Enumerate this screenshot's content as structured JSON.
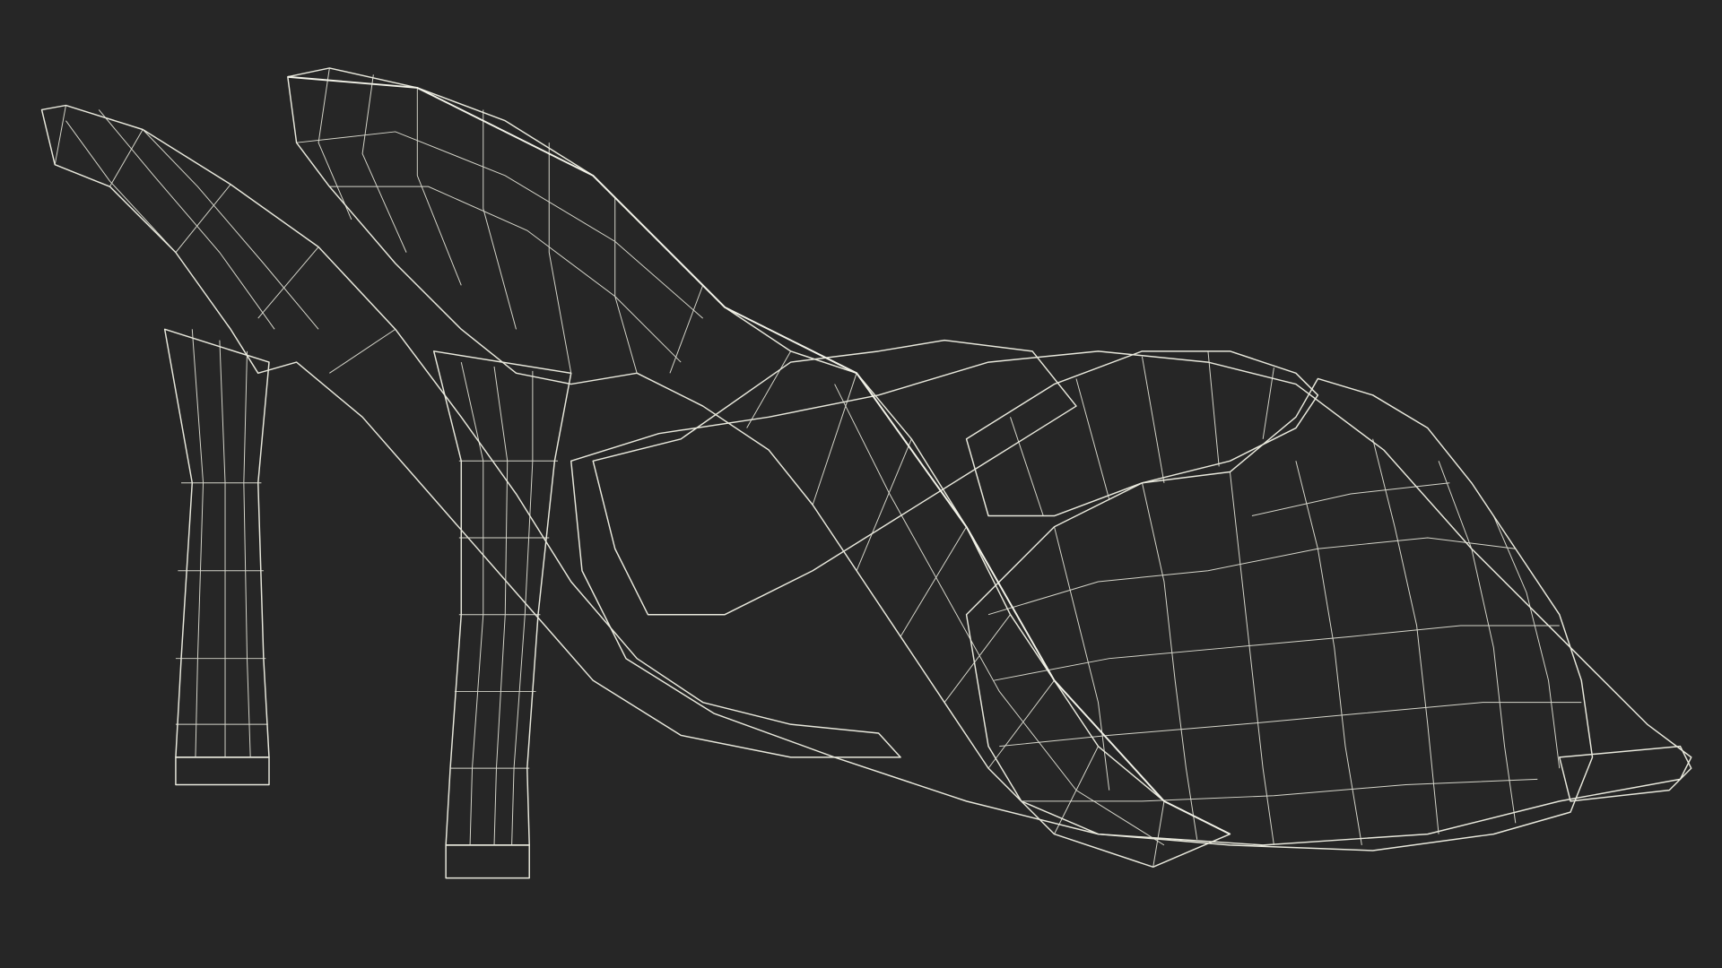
{
  "scene": {
    "background_color": "#262626",
    "mesh_color": "#7a7a6e",
    "mesh_shadow_color": "#4c4c44",
    "mesh_highlight_color": "#8e8e82",
    "wire_color": "#e8e8dc"
  }
}
